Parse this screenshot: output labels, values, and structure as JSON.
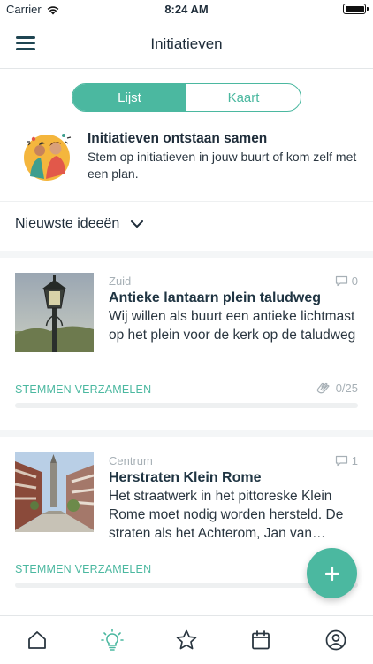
{
  "status_bar": {
    "carrier": "Carrier",
    "time": "8:24 AM",
    "battery_level": 1.0
  },
  "header": {
    "title": "Initiatieven",
    "menu_icon": "hamburger-icon"
  },
  "toggle": {
    "options": [
      "Lijst",
      "Kaart"
    ],
    "selected": "Lijst"
  },
  "intro": {
    "title": "Initiatieven ontstaan samen",
    "text": "Stem op initiatieven in jouw buurt of kom zelf met een plan."
  },
  "sort": {
    "label": "Nieuwste ideeën"
  },
  "cards": [
    {
      "district": "Zuid",
      "comments": "0",
      "title": "Antieke lantaarn plein taludweg",
      "description": "Wij willen als buurt een antieke lichtmast op het plein voor de kerk op de taludweg",
      "status": "STEMMEN VERZAMELEN",
      "votes": "0/25",
      "progress": 0
    },
    {
      "district": "Centrum",
      "comments": "1",
      "title": "Herstraten Klein Rome",
      "description": "Het straatwerk in het pittoreske Klein Rome moet nodig worden hersteld. De straten als het Achterom, Jan van Arkelstraat en Kerkstraat liggen erbij als…",
      "status": "STEMMEN VERZAMELEN",
      "progress": 0
    }
  ],
  "fab": {
    "icon": "plus-icon"
  },
  "tabbar": {
    "items": [
      {
        "icon": "home-icon"
      },
      {
        "icon": "lightbulb-icon",
        "active": true
      },
      {
        "icon": "star-icon"
      },
      {
        "icon": "calendar-icon"
      },
      {
        "icon": "profile-icon"
      }
    ]
  },
  "colors": {
    "accent": "#4bb8a0",
    "text": "#1f2d3a",
    "muted": "#a7b0b6",
    "divider": "#eef0f1"
  }
}
